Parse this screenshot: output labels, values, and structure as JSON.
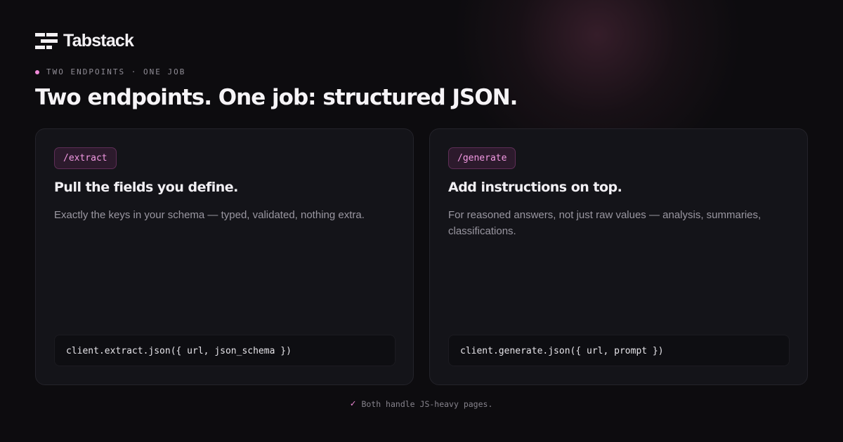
{
  "brand": {
    "name": "Tabstack",
    "icon": "stacked-bars-logo-icon"
  },
  "eyebrow": "TWO ENDPOINTS · ONE JOB",
  "headline": "Two endpoints. One job: structured JSON.",
  "cards": [
    {
      "endpoint": "/extract",
      "title": "Pull the fields you define.",
      "description": "Exactly the keys in your schema — typed, validated, nothing extra.",
      "code": "client.extract.json({ url, json_schema })"
    },
    {
      "endpoint": "/generate",
      "title": "Add instructions on top.",
      "description": "For reasoned answers, not just raw values — analysis, summaries, classifications.",
      "code": "client.generate.json({ url, prompt })"
    }
  ],
  "footer": {
    "check_icon": "checkmark-icon",
    "check": "✓",
    "text": "Both handle JS-heavy pages."
  },
  "colors": {
    "background": "#0d0c0f",
    "card": "#141419",
    "accent_pink": "#f08ad8",
    "pill_bg": "#2c1a2c",
    "pill_border": "#5f2e57"
  }
}
